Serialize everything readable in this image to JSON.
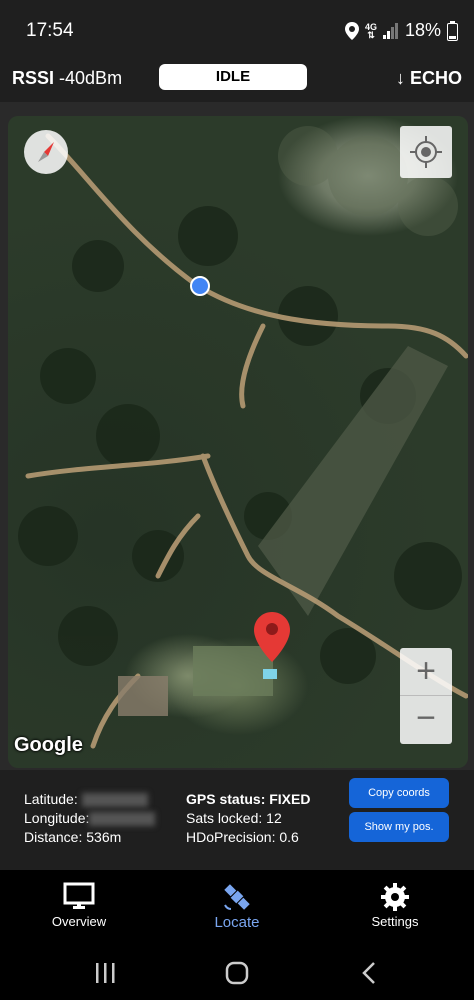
{
  "status_bar": {
    "time": "17:54",
    "battery": "18%",
    "network": "4G",
    "icons": [
      "location-pin-icon",
      "signal-icon",
      "battery-icon"
    ]
  },
  "header": {
    "rssi_label": "RSSI",
    "rssi_value": "-40dBm",
    "state": "IDLE",
    "echo_label": "↓ ECHO"
  },
  "map": {
    "attribution": "Google",
    "zoom_in": "+",
    "zoom_out": "−"
  },
  "info": {
    "latitude_label": "Latitude:",
    "longitude_label": "Longitude:",
    "distance": "Distance: 536m",
    "gps_status": "GPS status: FIXED",
    "sats_locked": "Sats locked: 12",
    "hdop": "HDoPrecision: 0.6",
    "copy_button": "Copy coords",
    "show_button": "Show my pos."
  },
  "tabs": [
    {
      "label": "Overview",
      "icon": "monitor-icon",
      "active": false
    },
    {
      "label": "Locate",
      "icon": "satellite-icon",
      "active": true
    },
    {
      "label": "Settings",
      "icon": "gear-icon",
      "active": false
    }
  ],
  "colors": {
    "accent": "#1565d8",
    "active_tab": "#7aa6f0",
    "marker": "#e53935",
    "position_dot": "#4285f4"
  }
}
